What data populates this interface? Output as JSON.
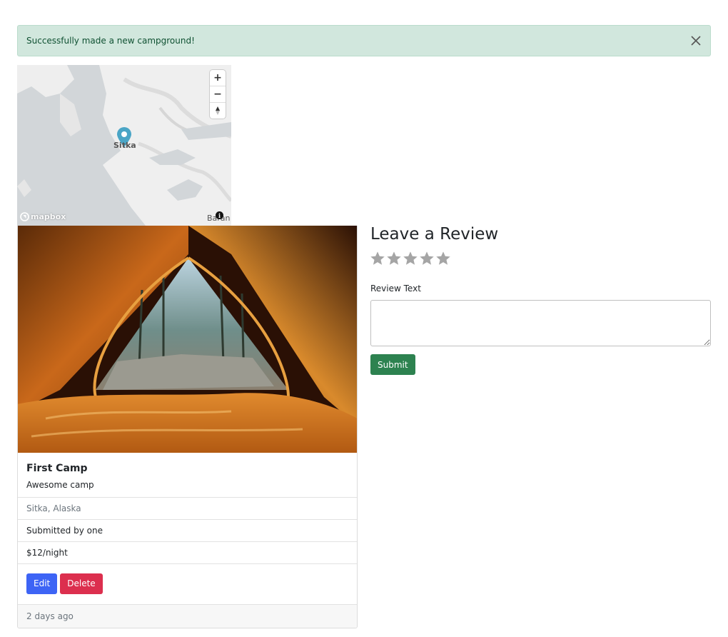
{
  "flash": {
    "message": "Successfully made a new campground!",
    "close_icon": "close-icon"
  },
  "map": {
    "place_label": "Sitka",
    "corner_label": "Baran",
    "attribution_logo": "mapbox",
    "controls": {
      "zoom_in": "+",
      "zoom_out": "−",
      "compass": "compass-icon"
    },
    "marker_color": "#4aa5c6"
  },
  "campground": {
    "title": "First Camp",
    "description": "Awesome camp",
    "location": "Sitka, Alaska",
    "submitted_by": "Submitted by one",
    "price": "$12/night",
    "edit_label": "Edit",
    "delete_label": "Delete",
    "posted": "2 days ago"
  },
  "review": {
    "heading": "Leave a Review",
    "rating_max": 5,
    "rating_value": 0,
    "text_label": "Review Text",
    "text_value": "",
    "submit_label": "Submit"
  },
  "colors": {
    "alert_bg": "#d1e7dd",
    "alert_text": "#0f5132",
    "edit_button": "#3d64f5",
    "delete_button": "#dc2f4e",
    "submit_button": "#2d8250",
    "star_empty": "#a5a5a5"
  }
}
